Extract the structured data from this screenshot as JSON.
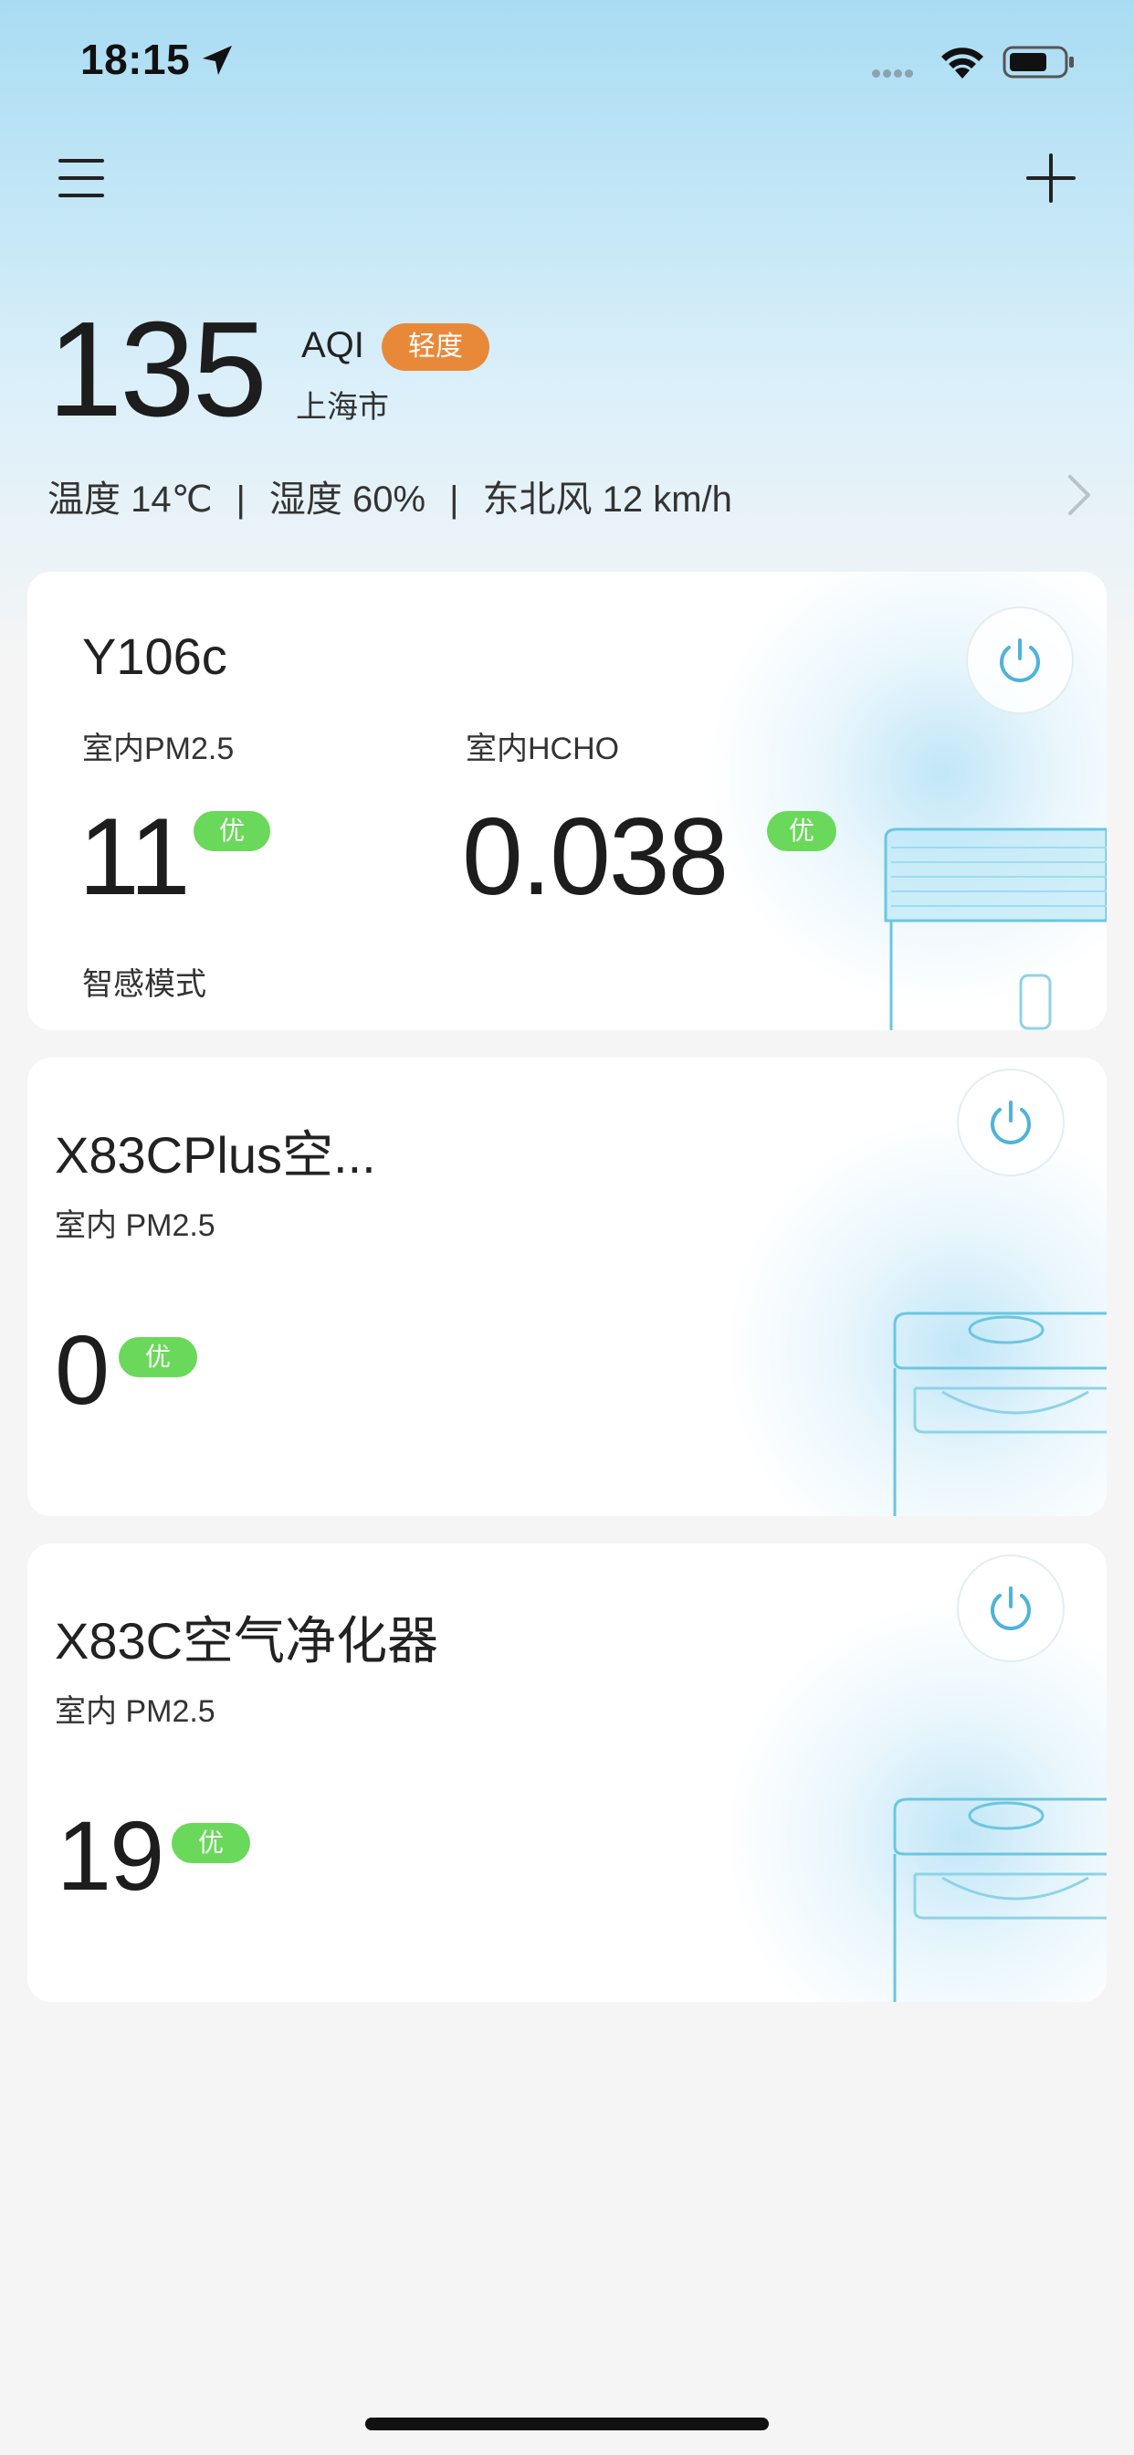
{
  "status_bar": {
    "time": "18:15"
  },
  "header": {
    "menu_icon": "menu-icon",
    "add_icon": "plus-icon"
  },
  "aqi": {
    "value": "135",
    "label": "AQI",
    "level": "轻度",
    "level_color": "#e8893a",
    "city": "上海市"
  },
  "weather": {
    "temperature": "温度 14℃",
    "humidity": "湿度 60%",
    "wind": "东北风 12 km/h"
  },
  "devices": [
    {
      "name": "Y106c",
      "metric1_label": "室内PM2.5",
      "metric1_value": "11",
      "metric1_badge": "优",
      "metric2_label": "室内HCHO",
      "metric2_value": "0.038",
      "metric2_badge": "优",
      "mode": "智感模式"
    },
    {
      "name": "X83CPlus空...",
      "metric1_label": "室内 PM2.5",
      "metric1_value": "0",
      "metric1_badge": "优"
    },
    {
      "name": "X83C空气净化器",
      "metric1_label": "室内 PM2.5",
      "metric1_value": "19",
      "metric1_badge": "优"
    }
  ],
  "colors": {
    "good_badge": "#6ad85a",
    "accent": "#4fb3d9"
  }
}
